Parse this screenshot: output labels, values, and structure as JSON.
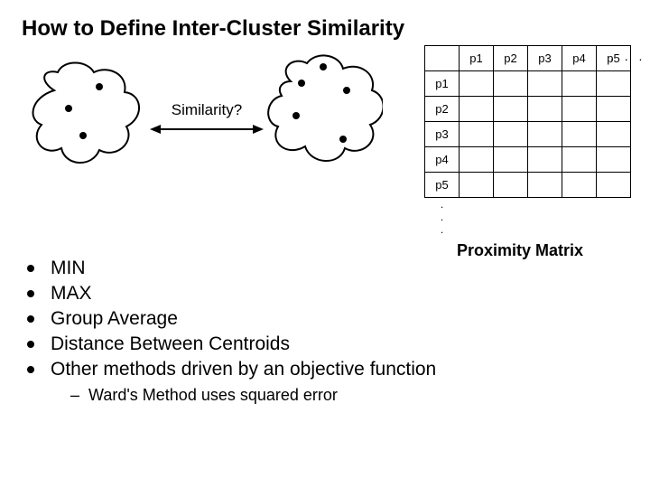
{
  "title": "How to Define Inter-Cluster Similarity",
  "diagram": {
    "label": "Similarity?"
  },
  "matrix": {
    "cols": [
      "p1",
      "p2",
      "p3",
      "p4",
      "p5"
    ],
    "rows": [
      "p1",
      "p2",
      "p3",
      "p4",
      "p5"
    ],
    "dots": ".",
    "ellipsis": ". . .",
    "caption": "Proximity Matrix"
  },
  "methods": {
    "items": [
      "MIN",
      "MAX",
      "Group Average",
      "Distance Between Centroids",
      "Other methods driven by an objective function"
    ],
    "subitem": "Ward's Method uses squared error"
  }
}
